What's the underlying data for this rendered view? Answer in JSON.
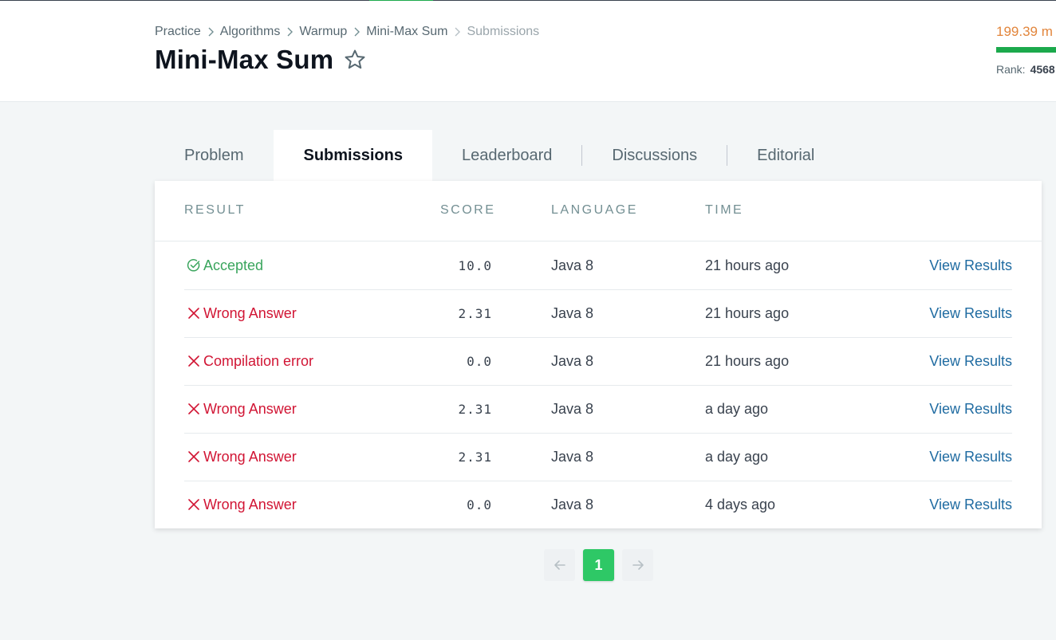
{
  "breadcrumb": {
    "items": [
      "Practice",
      "Algorithms",
      "Warmup",
      "Mini-Max Sum"
    ],
    "current": "Submissions"
  },
  "page_title": "Mini-Max Sum",
  "profile": {
    "score": "199.39 m",
    "rank_label": "Rank:",
    "rank_value": "4568"
  },
  "tabs": [
    "Problem",
    "Submissions",
    "Leaderboard",
    "Discussions",
    "Editorial"
  ],
  "active_tab": "Submissions",
  "table": {
    "headers": [
      "RESULT",
      "SCORE",
      "LANGUAGE",
      "TIME"
    ],
    "rows": [
      {
        "result": "Accepted",
        "score": "10.0",
        "language": "Java 8",
        "time": "21 hours ago",
        "action": "View Results"
      },
      {
        "result": "Wrong Answer",
        "score": "2.31",
        "language": "Java 8",
        "time": "21 hours ago",
        "action": "View Results"
      },
      {
        "result": "Compilation error",
        "score": "0.0",
        "language": "Java 8",
        "time": "21 hours ago",
        "action": "View Results"
      },
      {
        "result": "Wrong Answer",
        "score": "2.31",
        "language": "Java 8",
        "time": "a day ago",
        "action": "View Results"
      },
      {
        "result": "Wrong Answer",
        "score": "2.31",
        "language": "Java 8",
        "time": "a day ago",
        "action": "View Results"
      },
      {
        "result": "Wrong Answer",
        "score": "0.0",
        "language": "Java 8",
        "time": "4 days ago",
        "action": "View Results"
      }
    ]
  },
  "pagination": {
    "prev_icon": "arrow-left-icon",
    "current_page": "1",
    "next_icon": "arrow-right-icon"
  },
  "colors": {
    "accepted": "#3aa55d",
    "failed": "#d11534",
    "link": "#1f6ba1",
    "score_accent": "#e2853b",
    "progress": "#1ba94c",
    "page_active": "#2ec866"
  }
}
